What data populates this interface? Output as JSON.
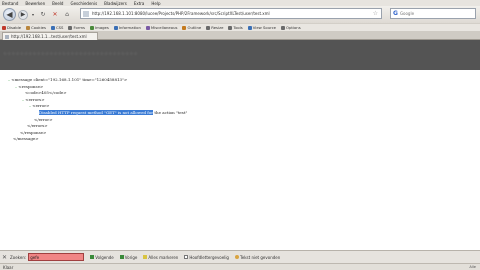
{
  "menubar": {
    "items": [
      "Bestand",
      "Bewerken",
      "Beeld",
      "Geschiedenis",
      "Bladwijzers",
      "Extra",
      "Help"
    ]
  },
  "navbar": {
    "back_icon": "back-arrow-icon",
    "url": "http://192.168.1.101:8080/lucee/Projects/PHP/2Framework/src/ScriptXLTest/user/test.xml",
    "search_placeholder": "Google"
  },
  "toolbar": {
    "items": [
      {
        "label": "Disable",
        "color": "#c0392b"
      },
      {
        "label": "Cookies",
        "color": "#b9853c"
      },
      {
        "label": "CSS",
        "color": "#3a6fb5"
      },
      {
        "label": "Forms",
        "color": "#6a6a6a"
      },
      {
        "label": "Images",
        "color": "#4a8a3a"
      },
      {
        "label": "Information",
        "color": "#3a6fb5"
      },
      {
        "label": "Miscellaneous",
        "color": "#7a5aa5"
      },
      {
        "label": "Outline",
        "color": "#c47a1e"
      },
      {
        "label": "Resize",
        "color": "#6a6a6a"
      },
      {
        "label": "Tools",
        "color": "#6a6a6a"
      },
      {
        "label": "View Source",
        "color": "#3a6fb5"
      },
      {
        "label": "Options",
        "color": "#6a6a6a"
      }
    ]
  },
  "tab": {
    "label": "http://192.168.1.1...test/user/test.xml"
  },
  "xml": {
    "message_open": "<message client=\"192.168.1.101\" time=\"1260458813\">",
    "response_open": "<response>",
    "code": "<code>405</code>",
    "errors_open": "<errors>",
    "error_open": "<error>",
    "error_highlight": "Disabled HTTP request method \"GET\" is not allowed for",
    "error_rest": "the action \"test\"",
    "error_close": "</error>",
    "errors_close": "</errors>",
    "response_close": "</response>",
    "message_close": "</message>"
  },
  "findbar": {
    "label": "Zoeken:",
    "query": "gefe",
    "next": "Volgende",
    "prev": "Vorige",
    "highlight_all": "Alles markeren",
    "match_case": "Hoofdlettergevoelig",
    "not_found": "Tekst niet gevonden"
  },
  "statusbar": {
    "left": "Klaar",
    "right": "Alle"
  }
}
